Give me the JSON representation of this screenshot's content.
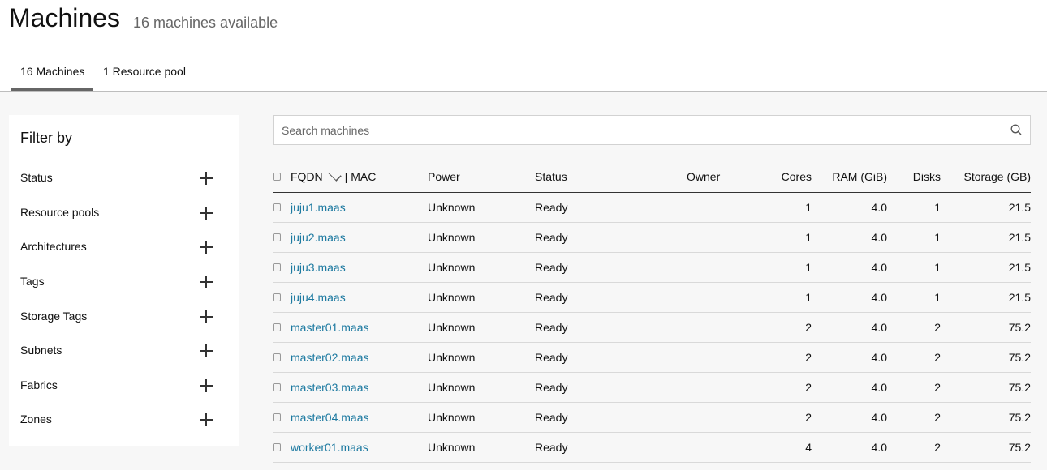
{
  "header": {
    "title": "Machines",
    "subtitle": "16 machines available"
  },
  "tabs": [
    {
      "label": "16 Machines",
      "active": true
    },
    {
      "label": "1 Resource pool",
      "active": false
    }
  ],
  "filter": {
    "title": "Filter by",
    "items": [
      "Status",
      "Resource pools",
      "Architectures",
      "Tags",
      "Storage Tags",
      "Subnets",
      "Fabrics",
      "Zones"
    ]
  },
  "search": {
    "placeholder": "Search machines",
    "value": ""
  },
  "table": {
    "columns": {
      "fqdn": "FQDN",
      "mac": "| MAC",
      "power": "Power",
      "status": "Status",
      "owner": "Owner",
      "cores": "Cores",
      "ram": "RAM (GiB)",
      "disks": "Disks",
      "storage": "Storage (GB)"
    },
    "rows": [
      {
        "fqdn": "juju1.maas",
        "power": "Unknown",
        "status": "Ready",
        "owner": "",
        "cores": "1",
        "ram": "4.0",
        "disks": "1",
        "storage": "21.5"
      },
      {
        "fqdn": "juju2.maas",
        "power": "Unknown",
        "status": "Ready",
        "owner": "",
        "cores": "1",
        "ram": "4.0",
        "disks": "1",
        "storage": "21.5"
      },
      {
        "fqdn": "juju3.maas",
        "power": "Unknown",
        "status": "Ready",
        "owner": "",
        "cores": "1",
        "ram": "4.0",
        "disks": "1",
        "storage": "21.5"
      },
      {
        "fqdn": "juju4.maas",
        "power": "Unknown",
        "status": "Ready",
        "owner": "",
        "cores": "1",
        "ram": "4.0",
        "disks": "1",
        "storage": "21.5"
      },
      {
        "fqdn": "master01.maas",
        "power": "Unknown",
        "status": "Ready",
        "owner": "",
        "cores": "2",
        "ram": "4.0",
        "disks": "2",
        "storage": "75.2"
      },
      {
        "fqdn": "master02.maas",
        "power": "Unknown",
        "status": "Ready",
        "owner": "",
        "cores": "2",
        "ram": "4.0",
        "disks": "2",
        "storage": "75.2"
      },
      {
        "fqdn": "master03.maas",
        "power": "Unknown",
        "status": "Ready",
        "owner": "",
        "cores": "2",
        "ram": "4.0",
        "disks": "2",
        "storage": "75.2"
      },
      {
        "fqdn": "master04.maas",
        "power": "Unknown",
        "status": "Ready",
        "owner": "",
        "cores": "2",
        "ram": "4.0",
        "disks": "2",
        "storage": "75.2"
      },
      {
        "fqdn": "worker01.maas",
        "power": "Unknown",
        "status": "Ready",
        "owner": "",
        "cores": "4",
        "ram": "4.0",
        "disks": "2",
        "storage": "75.2"
      }
    ]
  },
  "colors": {
    "link": "#1c79a0",
    "tab_indicator": "#666666",
    "background": "#f7f7f7"
  }
}
